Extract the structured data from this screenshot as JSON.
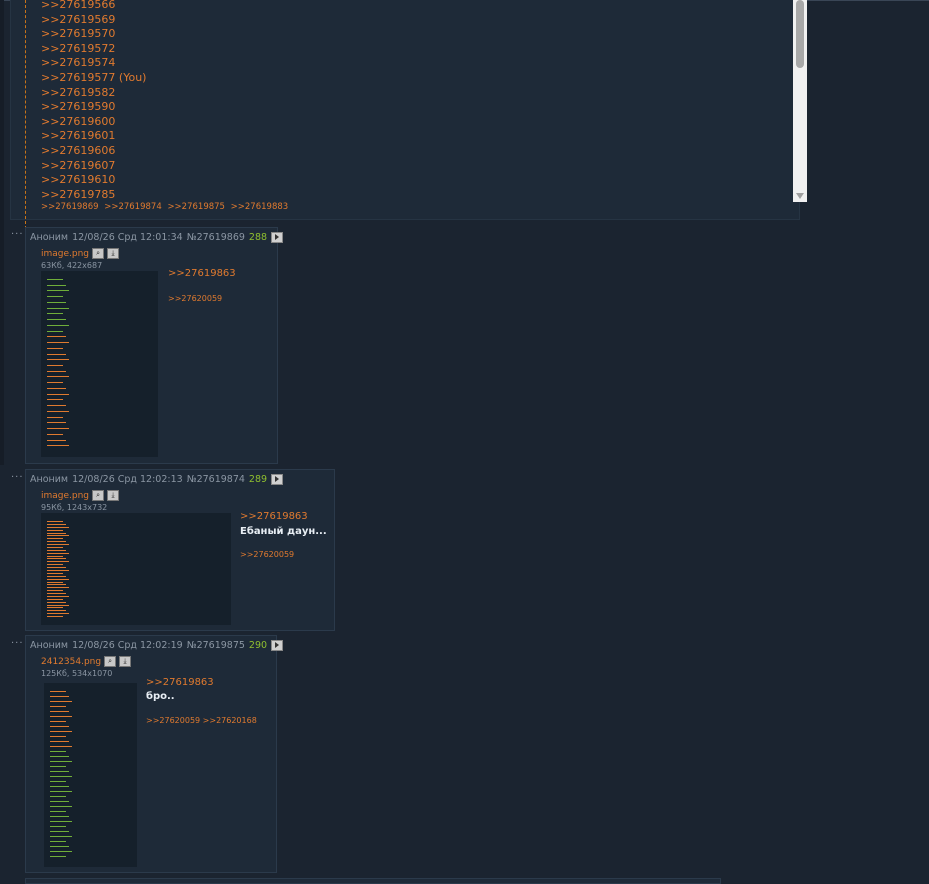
{
  "top_post": {
    "replies": [
      ">>27619566",
      ">>27619569",
      ">>27619570",
      ">>27619572",
      ">>27619574",
      ">>27619577",
      ">>27619582",
      ">>27619590",
      ">>27619600",
      ">>27619601",
      ">>27619606",
      ">>27619607",
      ">>27619610",
      ">>27619785"
    ],
    "you_marker": "(You)",
    "backrefs": [
      ">>27619869",
      ">>27619874",
      ">>27619875",
      ">>27619883"
    ]
  },
  "posts": [
    {
      "name": "Аноним",
      "date": "12/08/26 Срд 12:01:34",
      "id": "№27619869",
      "index": "288",
      "file_name": "image.png",
      "file_meta": "63Кб, 422x687",
      "reply_to": ">>27619863",
      "text": "",
      "backrefs": ">>27620059"
    },
    {
      "name": "Аноним",
      "date": "12/08/26 Срд 12:02:13",
      "id": "№27619874",
      "index": "289",
      "file_name": "image.png",
      "file_meta": "95Кб, 1243x732",
      "reply_to": ">>27619863",
      "text": "Ебаный даун...",
      "backrefs": ">>27620059"
    },
    {
      "name": "Аноним",
      "date": "12/08/26 Срд 12:02:19",
      "id": "№27619875",
      "index": "290",
      "file_name": "2412354.png",
      "file_meta": "125Кб, 534x1070",
      "reply_to": ">>27619863",
      "text": "бро..",
      "backrefs": ">>27620059 >>27620168"
    }
  ],
  "menu_dots": "...",
  "colors": {
    "background": "#1b2430",
    "post_bg": "#1e2a38",
    "link": "#e07a2f",
    "post_number": "#8fbf2f"
  },
  "icons": {
    "zoom": "magnifier-icon",
    "download": "download-icon",
    "play": "play-icon"
  }
}
